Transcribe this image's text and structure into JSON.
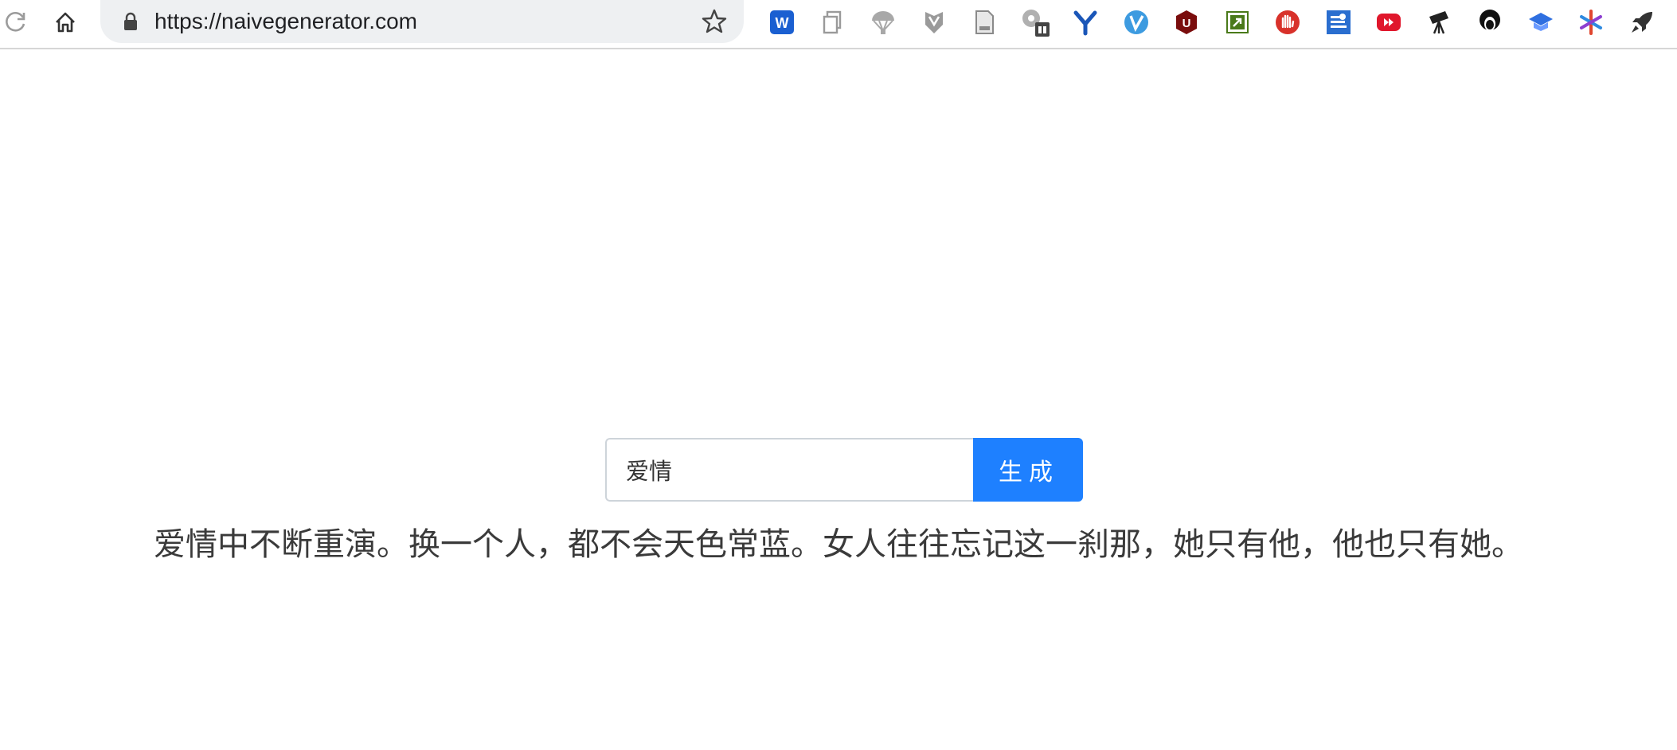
{
  "browser": {
    "url": "https://naivegenerator.com",
    "extensions": [
      {
        "name": "word-extension-icon",
        "color": "#1a5fd1",
        "text": "W"
      },
      {
        "name": "copy-pages-icon",
        "color": "#9a9a9a"
      },
      {
        "name": "parachute-icon",
        "color": "#9a9a9a"
      },
      {
        "name": "shield-extension-icon",
        "color": "#9a9a9a"
      },
      {
        "name": "document-icon",
        "color": "#9a9a9a"
      },
      {
        "name": "gear-badge-icon",
        "color": "#9a9a9a"
      },
      {
        "name": "y-extension-icon",
        "color": "#1a56b8",
        "text": "Y"
      },
      {
        "name": "v-extension-icon",
        "color": "#3d9be0",
        "text": "V"
      },
      {
        "name": "u-extension-icon",
        "color": "#7a0d0d",
        "text": "U"
      },
      {
        "name": "green-arrow-icon",
        "color": "#4a7a1a"
      },
      {
        "name": "red-hand-icon",
        "color": "#d8312a"
      },
      {
        "name": "blue-settings-icon",
        "color": "#2a6ecf"
      },
      {
        "name": "youtube-icon",
        "color": "#e0172c"
      },
      {
        "name": "telescope-icon",
        "color": "#222222"
      },
      {
        "name": "afro-avatar-icon",
        "color": "#111111"
      },
      {
        "name": "graduation-cap-icon",
        "color": "#2f6fe0"
      },
      {
        "name": "asterisk-color-icon",
        "color": "#e0452e"
      },
      {
        "name": "rocket-icon",
        "color": "#333333"
      }
    ]
  },
  "generator": {
    "input_value": "爱情",
    "button_label": "生成",
    "result_text": "爱情中不断重演。换一个人，都不会天色常蓝。女人往往忘记这一刹那，她只有他，他也只有她。"
  },
  "colors": {
    "accent": "#1e80ff",
    "text": "#3a3a3a"
  }
}
